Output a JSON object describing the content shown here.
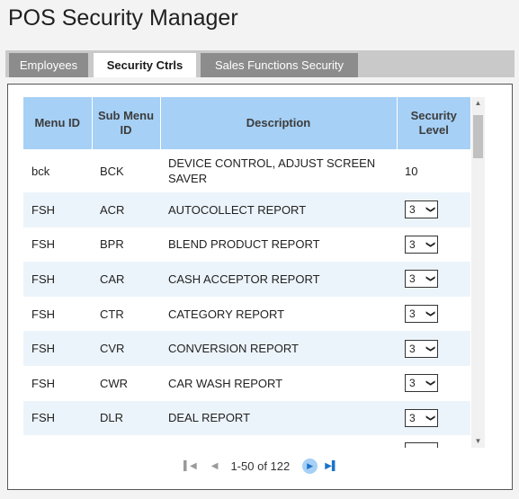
{
  "app": {
    "title": "POS Security Manager"
  },
  "tabs": [
    {
      "label": "Employees"
    },
    {
      "label": "Security Ctrls"
    },
    {
      "label": "Sales Functions Security"
    }
  ],
  "table": {
    "headers": {
      "menu_id": "Menu ID",
      "sub_menu_id": "Sub Menu ID",
      "description": "Description",
      "security_level": "Security Level"
    },
    "rows": [
      {
        "menu": "bck",
        "sub": "BCK",
        "desc": "DEVICE CONTROL, ADJUST SCREEN SAVER",
        "level": "10",
        "editable": false
      },
      {
        "menu": "FSH",
        "sub": "ACR",
        "desc": "AUTOCOLLECT REPORT",
        "level": "3",
        "editable": true
      },
      {
        "menu": "FSH",
        "sub": "BPR",
        "desc": "BLEND PRODUCT REPORT",
        "level": "3",
        "editable": true
      },
      {
        "menu": "FSH",
        "sub": "CAR",
        "desc": "CASH ACCEPTOR REPORT",
        "level": "3",
        "editable": true
      },
      {
        "menu": "FSH",
        "sub": "CTR",
        "desc": "CATEGORY REPORT",
        "level": "3",
        "editable": true
      },
      {
        "menu": "FSH",
        "sub": "CVR",
        "desc": "CONVERSION REPORT",
        "level": "3",
        "editable": true
      },
      {
        "menu": "FSH",
        "sub": "CWR",
        "desc": "CAR WASH REPORT",
        "level": "3",
        "editable": true
      },
      {
        "menu": "FSH",
        "sub": "DLR",
        "desc": "DEAL REPORT",
        "level": "3",
        "editable": true
      },
      {
        "menu": "",
        "sub": "",
        "desc": "",
        "level": "",
        "editable": true
      }
    ]
  },
  "pager": {
    "info": "1-50 of 122"
  },
  "icons": {
    "first": "first-page-icon",
    "prev": "prev-page-icon",
    "next": "next-page-icon",
    "last": "last-page-icon"
  },
  "colors": {
    "header_bg": "#a6d0f5",
    "alt_row": "#ecf4fb",
    "tab_inactive": "#8c8c8c"
  }
}
